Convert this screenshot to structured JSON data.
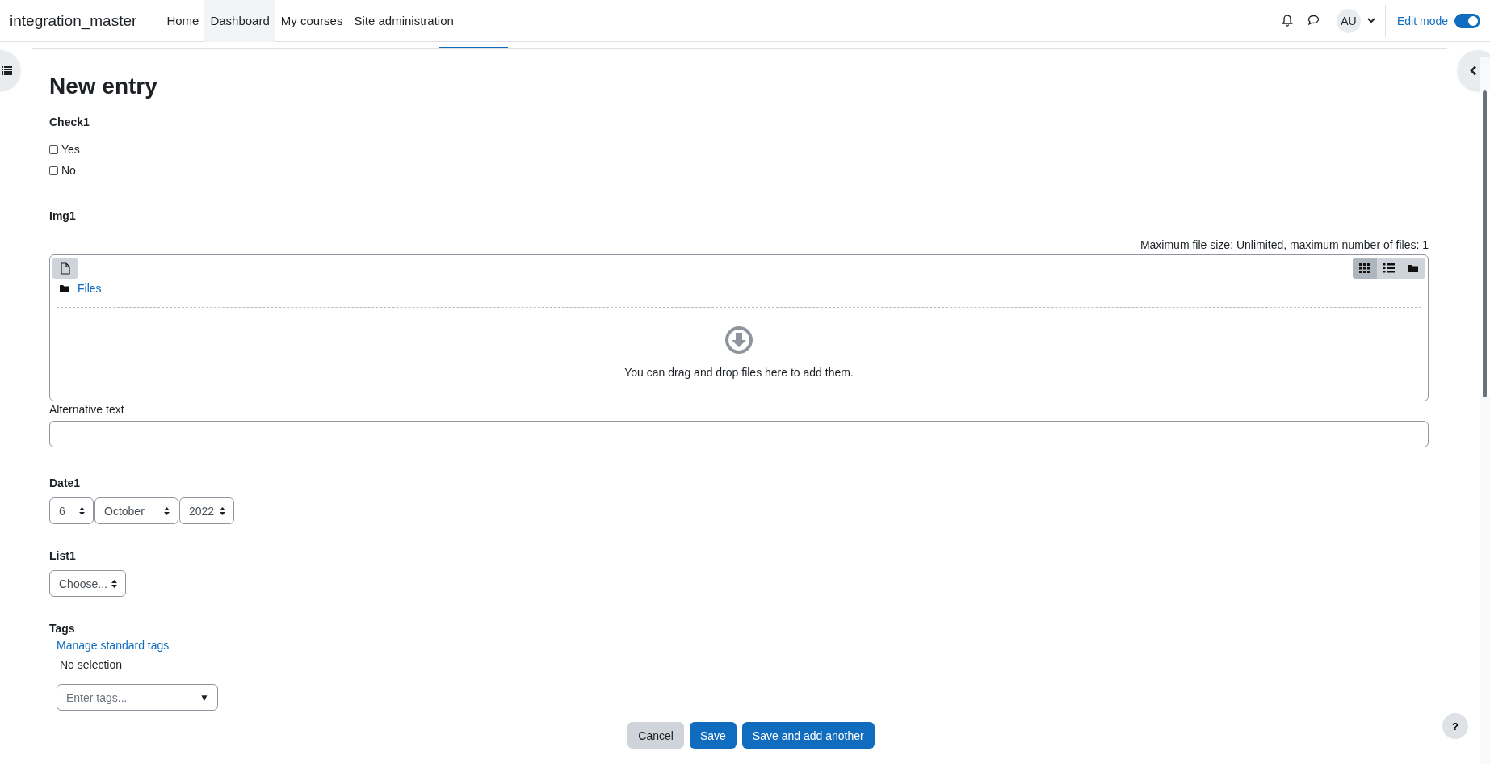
{
  "site_name": "integration_master",
  "nav": [
    {
      "label": "Home",
      "selected": false
    },
    {
      "label": "Dashboard",
      "selected": true
    },
    {
      "label": "My courses",
      "selected": false
    },
    {
      "label": "Site administration",
      "selected": false
    }
  ],
  "user": {
    "initials": "AU"
  },
  "edit_mode": {
    "label": "Edit mode",
    "on": true
  },
  "page_title": "New entry",
  "fields": [
    {
      "kind": "checkboxes",
      "label": "Check1",
      "options": [
        {
          "label": "Yes",
          "checked": false
        },
        {
          "label": "No",
          "checked": false
        }
      ]
    },
    {
      "kind": "filepicker",
      "label": "Img1",
      "limits": "Maximum file size: Unlimited, maximum number of files: 1",
      "folder": "Files",
      "views": [
        {
          "kind": "grid",
          "selected": true
        },
        {
          "kind": "list",
          "selected": false
        },
        {
          "kind": "tree",
          "selected": false
        }
      ],
      "drop_hint": "You can drag and drop files here to add them."
    },
    {
      "kind": "text",
      "label": "Alternative text"
    },
    {
      "kind": "date",
      "label": "Date1",
      "values": [
        "6",
        "October",
        "2022"
      ]
    },
    {
      "kind": "select",
      "label": "List1",
      "value": "Choose..."
    },
    {
      "kind": "tags",
      "label": "Tags",
      "link": "Manage standard tags",
      "status": "No selection",
      "placeholder": "Enter tags...",
      "dropdown_arrow": "▼"
    }
  ],
  "buttons": [
    {
      "label": "Cancel",
      "kind": "secondary"
    },
    {
      "label": "Save",
      "kind": "primary"
    },
    {
      "label": "Save and add another",
      "kind": "primary"
    }
  ],
  "help": "?"
}
